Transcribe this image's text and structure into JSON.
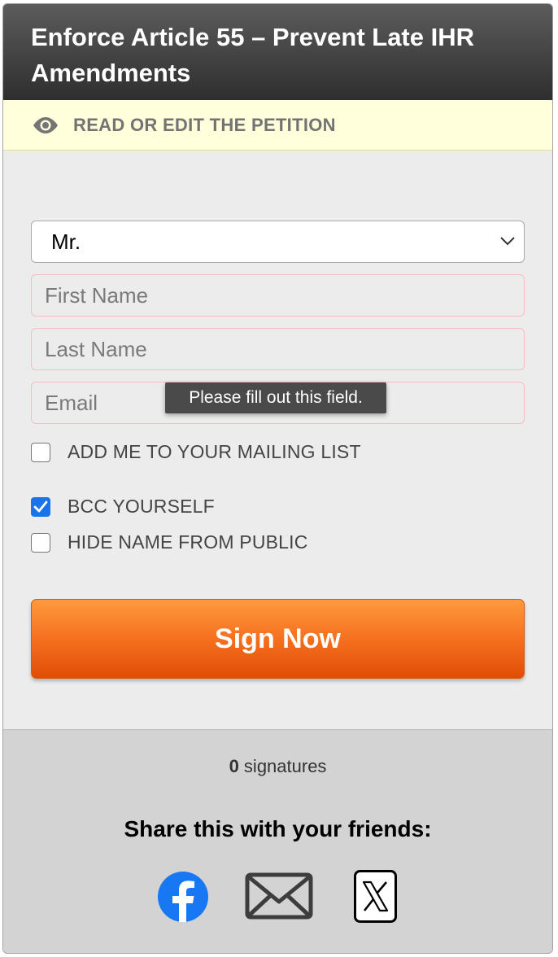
{
  "header": {
    "title": "Enforce Article 55 – Prevent Late IHR Amendments"
  },
  "read_bar": {
    "label": "READ OR EDIT THE PETITION",
    "icon": "eye-icon"
  },
  "form": {
    "salutation": {
      "value": "Mr."
    },
    "first_name": {
      "placeholder": "First Name"
    },
    "last_name": {
      "placeholder": "Last Name"
    },
    "email": {
      "placeholder": "Email"
    },
    "tooltip": "Please fill out this field.",
    "checkboxes": [
      {
        "label": "ADD ME TO YOUR MAILING LIST",
        "checked": false
      },
      {
        "label": "BCC YOURSELF",
        "checked": true
      },
      {
        "label": "HIDE NAME FROM PUBLIC",
        "checked": false
      }
    ],
    "submit_label": "Sign Now"
  },
  "footer": {
    "signature_count": "0",
    "signature_suffix": " signatures",
    "share_text": "Share this with your friends:",
    "share_icons": [
      "facebook-icon",
      "email-icon",
      "x-icon"
    ]
  },
  "colors": {
    "accent_orange": "#f5701f",
    "checkbox_blue": "#1a73e8",
    "facebook_blue": "#1877f2",
    "read_bar_bg": "#ffffdb"
  }
}
